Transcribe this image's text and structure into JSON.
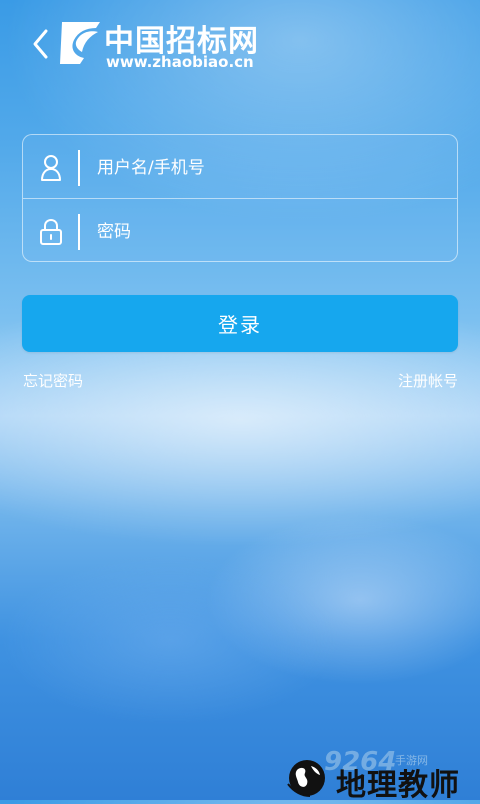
{
  "header": {
    "back_icon": "chevron-left-icon",
    "logo_icon": "zhaobiao-logo",
    "brand_name": "中国招标网",
    "brand_url": "www.zhaobiao.cn"
  },
  "form": {
    "username": {
      "icon": "user-icon",
      "placeholder": "用户名/手机号",
      "value": ""
    },
    "password": {
      "icon": "lock-icon",
      "placeholder": "密码",
      "value": ""
    }
  },
  "actions": {
    "login_label": "登录",
    "forgot_label": "忘记密码",
    "register_label": "注册帐号"
  },
  "watermark": {
    "number": "9264",
    "small": "手游网",
    "text": "地理教师"
  },
  "colors": {
    "button": "#16a7ee",
    "background_top": "#3a9be6",
    "background_bottom": "#2f7fd6"
  }
}
